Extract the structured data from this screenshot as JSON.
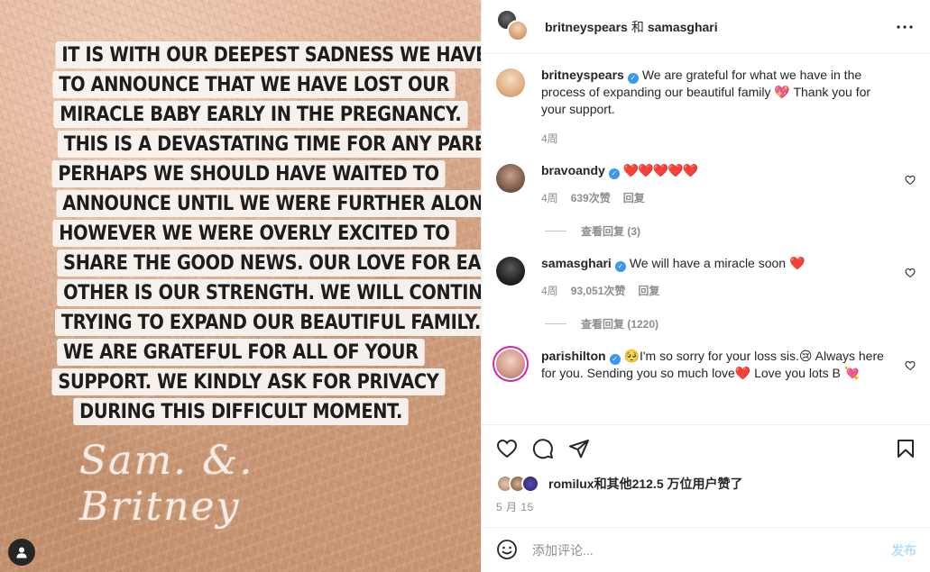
{
  "image": {
    "announcement_lines": [
      "It is with our deepest sadness we have",
      "to announce that we have lost our",
      "miracle baby early in the pregnancy.",
      "This is a devastating time for any parent.",
      "Perhaps we should have waited to",
      "announce until we were further along",
      "however we were overly excited to",
      "share the good news. Our love for each",
      "other is our strength. We will continue",
      "trying to expand our beautiful family.",
      "We are grateful for all of your",
      "support.  We kindly ask for privacy",
      "during this difficult moment."
    ],
    "signature": "Sam.  &.  Britney"
  },
  "header": {
    "user1": "britneyspears",
    "conjunction": "和",
    "user2": "samasghari"
  },
  "caption": {
    "user": "britneyspears",
    "text": "We are grateful for what we have in the process of expanding our beautiful family 💖 Thank you for your support.",
    "time": "4周"
  },
  "comments": [
    {
      "user": "bravoandy",
      "text": "❤️❤️❤️❤️❤️",
      "time": "4周",
      "likes": "639次赞",
      "reply": "回复",
      "view_replies": "查看回复 (3)"
    },
    {
      "user": "samasghari",
      "text": "We will have a miracle soon ❤️",
      "time": "4周",
      "likes": "93,051次赞",
      "reply": "回复",
      "view_replies": "查看回复 (1220)"
    },
    {
      "user": "parishilton",
      "text": "🥺I'm so sorry for your loss sis.😢 Always here for you. Sending you so much love❤️ Love you lots B 💘"
    }
  ],
  "likes": {
    "text": "romilux和其他212.5 万位用户赞了"
  },
  "date": "5 月 15",
  "add_comment": {
    "placeholder": "添加评论...",
    "post_label": "发布"
  },
  "colors": {
    "verified": "#3897f0",
    "heart": "#ed4956",
    "post_disabled": "#b2dffc",
    "muted": "#8e8e8e"
  }
}
